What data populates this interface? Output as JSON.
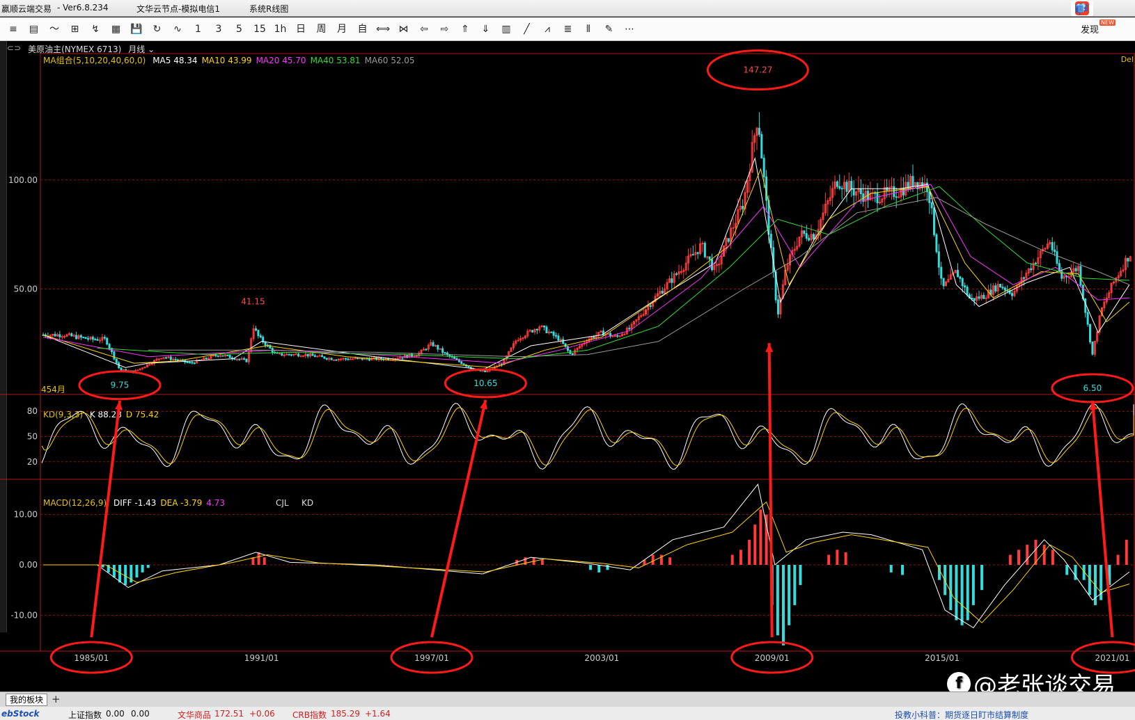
{
  "window": {
    "app_title": "赢顺云端交易",
    "version": "- Ver6.8.234",
    "node": "文华云节点-模拟电信1",
    "menu_item": "系统R线图",
    "discover_label": "发现",
    "new_badge": "NEW"
  },
  "ime": {
    "items": [
      "中",
      "°,",
      "☺",
      "🎤",
      "⌨",
      "👕",
      "▦"
    ]
  },
  "toolbar": {
    "buttons": [
      "≡",
      "▤",
      "〜",
      "⊞",
      "↯",
      "▦",
      "💾",
      "↻",
      "∿",
      "1",
      "3",
      "5",
      "15",
      "1h",
      "日",
      "周",
      "月",
      "自",
      "⟺",
      "⋈",
      "⇦",
      "⇨",
      "⇑",
      "⇓",
      "▥",
      "╱",
      "⩘",
      "≣",
      "⫴",
      "✎",
      "⋯"
    ]
  },
  "chart_header": {
    "symbol": "美原油主(NYMEX 6713)",
    "period": "月线"
  },
  "ma_legend": {
    "label": "MA组合(5,10,20,40,60,0)",
    "items": [
      {
        "text": "MA5 48.34",
        "color": "#ffffff"
      },
      {
        "text": "MA10 43.99",
        "color": "#ffd400"
      },
      {
        "text": "MA20 45.70",
        "color": "#ff33ff"
      },
      {
        "text": "MA40 53.81",
        "color": "#33dd33"
      },
      {
        "text": "MA60 52.05",
        "color": "#9a9a9a"
      }
    ],
    "right_text": "Del"
  },
  "kd_legend": {
    "label": "KD(9,3,3)",
    "items": [
      {
        "text": "K 88.28",
        "color": "#ffffff"
      },
      {
        "text": "D 75.42",
        "color": "#ffd400"
      }
    ]
  },
  "macd_legend": {
    "label": "MACD(12,26,9)",
    "items": [
      {
        "text": "DIFF -1.43",
        "color": "#ffffff"
      },
      {
        "text": "DEA -3.79",
        "color": "#ffd400"
      },
      {
        "text": "4.73",
        "color": "#ff33ff"
      }
    ],
    "extra": [
      "CJL",
      "KD"
    ]
  },
  "price_axis": {
    "ticks": [
      {
        "value": 100,
        "label": "100.00"
      },
      {
        "value": 50,
        "label": "50.00"
      }
    ]
  },
  "kd_axis": {
    "ticks": [
      {
        "value": 80,
        "label": "80"
      },
      {
        "value": 50,
        "label": "50"
      },
      {
        "value": 20,
        "label": "20"
      }
    ]
  },
  "macd_axis": {
    "ticks": [
      {
        "value": 10,
        "label": "10.00"
      },
      {
        "value": 0,
        "label": "0.00"
      },
      {
        "value": -10,
        "label": "-10.00"
      }
    ]
  },
  "bar_count_label": "454月",
  "annotations": [
    {
      "text": "9.75",
      "x": 1986.0,
      "y": 9.75,
      "color": "#33dddd"
    },
    {
      "text": "10.65",
      "x": 1998.9,
      "y": 10.65,
      "color": "#33dddd"
    },
    {
      "text": "41.15",
      "x": 1990.7,
      "y": 41.15,
      "color": "#ff4a4a"
    },
    {
      "text": "147.27",
      "x": 2008.5,
      "y": 147.27,
      "color": "#ff4a4a"
    },
    {
      "text": "6.50",
      "x": 2020.3,
      "y": 6.5,
      "color": "#33dddd"
    }
  ],
  "chart_data": {
    "type": "line",
    "title": "美原油主(NYMEX 6713) 月线",
    "x_label": "",
    "y_label": "",
    "x_ticks": [
      "1985/01",
      "1991/01",
      "1997/01",
      "2003/01",
      "2009/01",
      "2015/01",
      "2021/01"
    ],
    "x_range": [
      1983.2,
      2021.8
    ],
    "price_range": [
      2,
      158
    ],
    "price_series": {
      "name": "",
      "x": [
        1983.3,
        1984.0,
        1985.0,
        1985.5,
        1986.0,
        1986.5,
        1987.5,
        1988.5,
        1989.5,
        1990.5,
        1990.7,
        1990.9,
        1991.5,
        1992.5,
        1993.5,
        1994.5,
        1995.5,
        1996.5,
        1997.0,
        1997.5,
        1998.5,
        1998.9,
        1999.5,
        2000.0,
        2000.8,
        2001.5,
        2001.9,
        2002.5,
        2003.0,
        2003.5,
        2004.0,
        2004.8,
        2005.5,
        2006.5,
        2007.0,
        2007.5,
        2008.0,
        2008.5,
        2008.9,
        2009.2,
        2009.5,
        2010.0,
        2010.5,
        2011.3,
        2011.9,
        2012.5,
        2013.5,
        2014.0,
        2014.5,
        2015.0,
        2015.5,
        2016.0,
        2016.5,
        2017.0,
        2017.5,
        2018.0,
        2018.8,
        2019.2,
        2019.8,
        2020.3,
        2020.6,
        2021.0,
        2021.6
      ],
      "y": [
        29,
        29,
        27,
        27,
        13,
        12,
        19,
        16,
        20,
        17,
        33,
        28,
        20,
        20,
        18,
        18,
        18,
        20,
        25,
        20,
        13,
        12,
        16,
        27,
        33,
        27,
        20,
        27,
        30,
        28,
        32,
        45,
        55,
        70,
        58,
        75,
        90,
        130,
        75,
        38,
        60,
        75,
        75,
        100,
        95,
        92,
        95,
        100,
        97,
        50,
        58,
        45,
        47,
        52,
        48,
        58,
        72,
        55,
        60,
        20,
        40,
        52,
        66
      ]
    },
    "ma_series": [
      {
        "name": "MA5",
        "color": "#ffffff",
        "x": [
          1983.3,
          1986.2,
          1987,
          1990,
          1991,
          1995,
          1998.8,
          2000.5,
          2003,
          2005,
          2007,
          2008.4,
          2009.3,
          2010.5,
          2011.8,
          2013.5,
          2014.5,
          2015.5,
          2016.3,
          2018,
          2019.5,
          2020.5,
          2021.6
        ],
        "y": [
          29,
          14,
          16,
          18,
          26,
          19,
          13,
          24,
          29,
          46,
          62,
          110,
          44,
          73,
          96,
          96,
          98,
          52,
          42,
          53,
          60,
          30,
          52
        ]
      },
      {
        "name": "MA10",
        "color": "#ffd400",
        "x": [
          1983.3,
          1986.5,
          1988,
          1991.2,
          1994,
          1999.2,
          2001,
          2003,
          2005.5,
          2007.5,
          2008.6,
          2009.6,
          2011,
          2012.5,
          2014.5,
          2015.8,
          2016.8,
          2018.5,
          2019.8,
          2020.8,
          2021.6
        ],
        "y": [
          29,
          16,
          17,
          24,
          19,
          14,
          22,
          28,
          50,
          70,
          105,
          52,
          82,
          94,
          97,
          62,
          46,
          58,
          57,
          35,
          44
        ]
      },
      {
        "name": "MA20",
        "color": "#ff33ff",
        "x": [
          1983.3,
          1987,
          1991.5,
          1995,
          1999.5,
          2001.5,
          2004,
          2006.5,
          2008.7,
          2010,
          2012,
          2014.6,
          2016,
          2017.5,
          2019,
          2020.5,
          2021.6
        ],
        "y": [
          28,
          19,
          22,
          20,
          16,
          22,
          31,
          55,
          88,
          60,
          90,
          98,
          65,
          52,
          60,
          45,
          46
        ]
      },
      {
        "name": "MA40",
        "color": "#33dd33",
        "x": [
          1985.2,
          1989,
          1992,
          1996,
          2000,
          2002.5,
          2005,
          2007.5,
          2009.2,
          2011,
          2013,
          2014.9,
          2016.5,
          2018,
          2020,
          2021.6
        ],
        "y": [
          23,
          20,
          21,
          20,
          18,
          22,
          33,
          60,
          82,
          75,
          88,
          97,
          78,
          62,
          55,
          54
        ]
      },
      {
        "name": "MA60",
        "color": "#9a9a9a",
        "x": [
          1987,
          1991,
          1995,
          2000,
          2002.5,
          2005,
          2008,
          2010,
          2012,
          2014.8,
          2016.5,
          2018.5,
          2020.5,
          2021.6
        ],
        "y": [
          22,
          22,
          21,
          19,
          20,
          26,
          50,
          65,
          85,
          92,
          80,
          68,
          58,
          52
        ]
      }
    ],
    "kd": {
      "range": [
        0,
        100
      ],
      "k": {
        "name": "K",
        "color": "#ffffff",
        "value": 88.28
      },
      "d": {
        "name": "D",
        "color": "#ffd400",
        "value": 75.42
      }
    },
    "macd": {
      "range": [
        -17,
        17
      ],
      "diff_points": {
        "x": [
          1983.3,
          1985.2,
          1986.3,
          1987.5,
          1989.5,
          1990.8,
          1992,
          1995,
          1998.8,
          2000.5,
          2002.5,
          2004,
          2005.5,
          2007.3,
          2008.5,
          2009.1,
          2010.2,
          2011.5,
          2012.5,
          2014.3,
          2015.1,
          2016.1,
          2017.2,
          2018.6,
          2019.3,
          2020.3,
          2021.6
        ],
        "y": [
          0,
          0,
          -4.5,
          -1.2,
          0,
          2.5,
          0.5,
          0,
          -1.8,
          1.5,
          0.3,
          -1,
          5,
          7.5,
          16,
          0,
          5,
          6.5,
          6,
          3,
          -9,
          -12.5,
          -4,
          5,
          1,
          -7,
          -1.4
        ]
      },
      "dea_points": {
        "x": [
          1983.3,
          1985.5,
          1986.6,
          1988,
          1990,
          1991.2,
          1993,
          1998.9,
          2001,
          2003,
          2004.3,
          2006,
          2007.6,
          2008.8,
          2009.5,
          2010.5,
          2011.8,
          2014.5,
          2015.4,
          2016.4,
          2017.5,
          2018.8,
          2019.6,
          2020.6,
          2021.6
        ],
        "y": [
          0,
          0,
          -3.5,
          -1.5,
          0.5,
          2,
          0.4,
          -1.4,
          1.2,
          0.3,
          -0.6,
          4,
          6.5,
          12.5,
          2.5,
          4.5,
          6,
          3.5,
          -6.5,
          -11.5,
          -5,
          4,
          1.5,
          -5.5,
          -3.8
        ]
      },
      "bars": {
        "x": [
          1985.4,
          1985.6,
          1985.8,
          1986.0,
          1986.2,
          1986.4,
          1986.6,
          1986.8,
          1987.0,
          1990.7,
          1990.9,
          1991.1,
          2000.0,
          2000.3,
          2000.6,
          2000.9,
          2002.6,
          2002.9,
          2003.2,
          2004.5,
          2004.8,
          2005.1,
          2005.4,
          2007.6,
          2007.9,
          2008.2,
          2008.4,
          2008.6,
          2008.8,
          2009.0,
          2009.2,
          2009.4,
          2009.6,
          2009.8,
          2010.0,
          2011.0,
          2011.3,
          2011.6,
          2013.2,
          2013.6,
          2014.9,
          2015.1,
          2015.3,
          2015.5,
          2015.7,
          2015.9,
          2016.1,
          2016.4,
          2017.4,
          2017.7,
          2018.0,
          2018.3,
          2018.6,
          2018.9,
          2019.4,
          2019.7,
          2020.0,
          2020.2,
          2020.4,
          2020.6,
          2020.9,
          2021.2,
          2021.5
        ],
        "y": [
          -0.5,
          -1.5,
          -2.5,
          -3.5,
          -4,
          -3.5,
          -2.5,
          -1.5,
          -0.6,
          1.5,
          2.5,
          1.5,
          1,
          1.5,
          1.5,
          1,
          -1,
          -1.5,
          -1,
          1,
          2,
          2,
          1.5,
          2,
          3,
          5,
          8,
          11,
          10,
          -8,
          -14,
          -16,
          -12,
          -8,
          -4,
          2,
          3,
          2.5,
          -1.5,
          -2,
          -3,
          -6,
          -9,
          -11,
          -12,
          -11,
          -8,
          -5,
          2,
          3,
          4,
          5,
          4,
          3,
          -2,
          -3,
          -3,
          -6,
          -8,
          -7,
          -4,
          2,
          5
        ]
      }
    }
  },
  "tabs": {
    "mine": "我的板块",
    "add": "+"
  },
  "statusbar": {
    "logo": "ebStock",
    "idx1_name": "上证指数",
    "idx1_value": "0.00",
    "idx1_change": "0.00",
    "idx2_name": "文华商品",
    "idx2_value": "172.51",
    "idx2_change": "+0.06",
    "idx3_name": "CRB指数",
    "idx3_value": "185.29",
    "idx3_change": "+1.64",
    "tip": "投教小科普：期货逐日盯市结算制度"
  },
  "watermark": {
    "text": "@老张谈交易"
  }
}
